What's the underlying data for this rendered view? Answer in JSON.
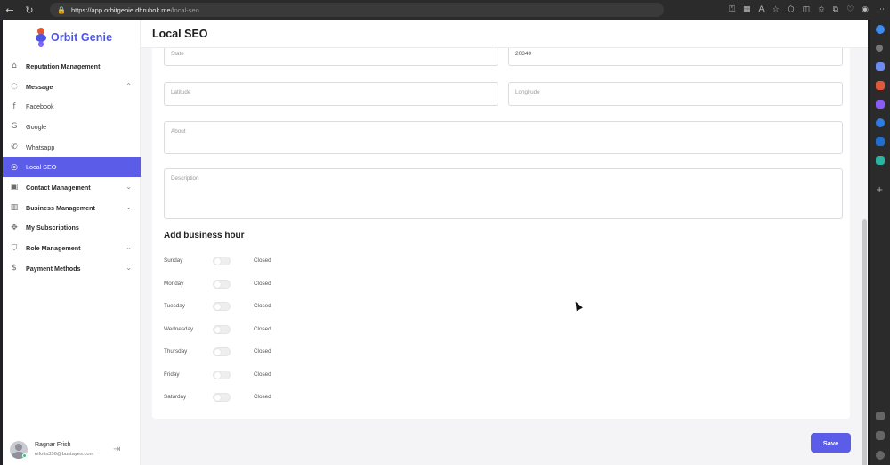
{
  "browser": {
    "url_host": "https://app.orbitgenie.dhrubok.me",
    "url_path": "/local-seo"
  },
  "sidebar": {
    "logo_text": "Orbit Genie",
    "items": [
      {
        "label": "Reputation Management",
        "icon": "building-icon",
        "type": "main"
      },
      {
        "label": "Message",
        "icon": "chat-icon",
        "type": "main",
        "chevron": "up"
      },
      {
        "label": "Facebook",
        "icon": "facebook-icon",
        "type": "sub"
      },
      {
        "label": "Google",
        "icon": "google-icon",
        "type": "sub"
      },
      {
        "label": "Whatsapp",
        "icon": "whatsapp-icon",
        "type": "sub"
      },
      {
        "label": "Local SEO",
        "icon": "location-icon",
        "type": "sub",
        "active": true
      },
      {
        "label": "Contact Management",
        "icon": "contact-icon",
        "type": "main",
        "chevron": "down"
      },
      {
        "label": "Business Management",
        "icon": "business-icon",
        "type": "main",
        "chevron": "down"
      },
      {
        "label": "My Subscriptions",
        "icon": "subscription-icon",
        "type": "main"
      },
      {
        "label": "Role Management",
        "icon": "shield-icon",
        "type": "main",
        "chevron": "down"
      },
      {
        "label": "Payment Methods",
        "icon": "dollar-icon",
        "type": "main",
        "chevron": "down"
      }
    ],
    "user": {
      "name": "Ragnar Frish",
      "email": "nifotis356@bustayes.com"
    }
  },
  "header": {
    "title": "Local SEO"
  },
  "form": {
    "state": {
      "placeholder": "State"
    },
    "zip": {
      "value": "20340"
    },
    "latitude": {
      "placeholder": "Latitude"
    },
    "longitude": {
      "placeholder": "Longitude"
    },
    "about": {
      "placeholder": "About"
    },
    "description": {
      "placeholder": "Description"
    }
  },
  "business_hours": {
    "title": "Add business hour",
    "days": [
      {
        "day": "Sunday",
        "status": "Closed",
        "enabled": false
      },
      {
        "day": "Monday",
        "status": "Closed",
        "enabled": false
      },
      {
        "day": "Tuesday",
        "status": "Closed",
        "enabled": false
      },
      {
        "day": "Wednesday",
        "status": "Closed",
        "enabled": false
      },
      {
        "day": "Thursday",
        "status": "Closed",
        "enabled": false
      },
      {
        "day": "Friday",
        "status": "Closed",
        "enabled": false
      },
      {
        "day": "Saturday",
        "status": "Closed",
        "enabled": false
      }
    ]
  },
  "actions": {
    "save_label": "Save"
  },
  "colors": {
    "accent": "#5b5ce8"
  }
}
